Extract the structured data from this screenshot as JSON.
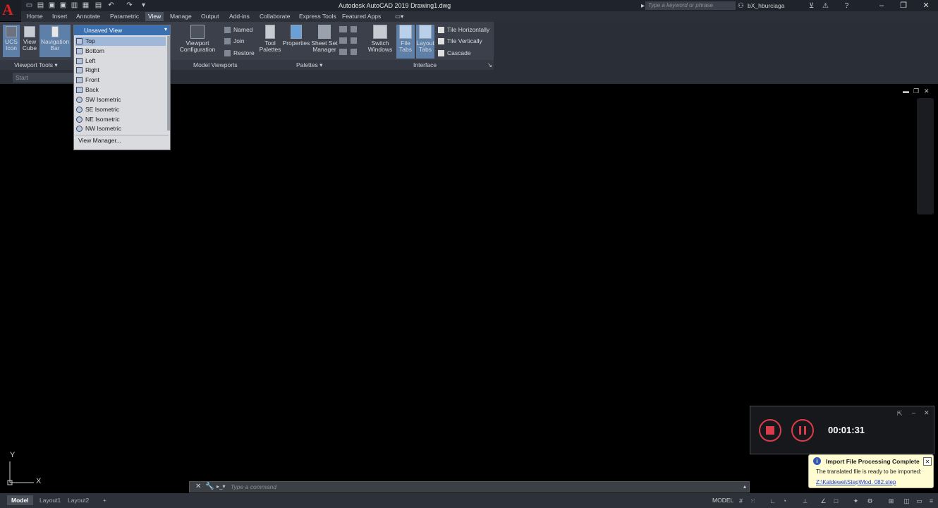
{
  "window": {
    "title": "Autodesk AutoCAD 2019   Drawing1.dwg",
    "logo": "A"
  },
  "search": {
    "placeholder": "Type a keyword or phrase"
  },
  "user": {
    "name": "bX_hburciaga"
  },
  "menu_tabs": [
    "Home",
    "Insert",
    "Annotate",
    "Parametric",
    "View",
    "Manage",
    "Output",
    "Add-ins",
    "Collaborate",
    "Express Tools",
    "Featured Apps"
  ],
  "active_tab": "View",
  "ribbon": {
    "ucs_icon": "UCS\nIcon",
    "view_cube": "View\nCube",
    "navigation_bar": "Navigation\nBar",
    "viewport_tools": "Viewport Tools",
    "viewport_configuration": "Viewport\nConfiguration",
    "named": "Named",
    "join": "Join",
    "restore": "Restore",
    "model_viewports": "Model Viewports",
    "tool_palettes": "Tool\nPalettes",
    "properties": "Properties",
    "sheet_set_manager": "Sheet Set\nManager",
    "palettes": "Palettes",
    "switch_windows": "Switch\nWindows",
    "file_tabs": "File\nTabs",
    "layout_tabs": "Layout\nTabs",
    "tile_horizontally": "Tile Horizontally",
    "tile_vertically": "Tile Vertically",
    "cascade": "Cascade",
    "interface": "Interface"
  },
  "view_dropdown": {
    "current": "Unsaved View",
    "items": [
      "Top",
      "Bottom",
      "Left",
      "Right",
      "Front",
      "Back",
      "SW Isometric",
      "SE Isometric",
      "NE Isometric",
      "NW Isometric"
    ],
    "selected": "Top",
    "manager": "View Manager..."
  },
  "file_tab": {
    "label": "Start"
  },
  "ucs": {
    "x": "X",
    "y": "Y"
  },
  "command_line": {
    "placeholder": "Type a command"
  },
  "recorder": {
    "time": "00:01:31"
  },
  "notification": {
    "title": "Import File Processing Complete",
    "body": "The translated file is ready to be imported:",
    "link": "Z:\\Kaldewei\\Step\\Mod. 082.step"
  },
  "layout_tabs": [
    "Model",
    "Layout1",
    "Layout2"
  ],
  "status": {
    "model": "MODEL"
  }
}
